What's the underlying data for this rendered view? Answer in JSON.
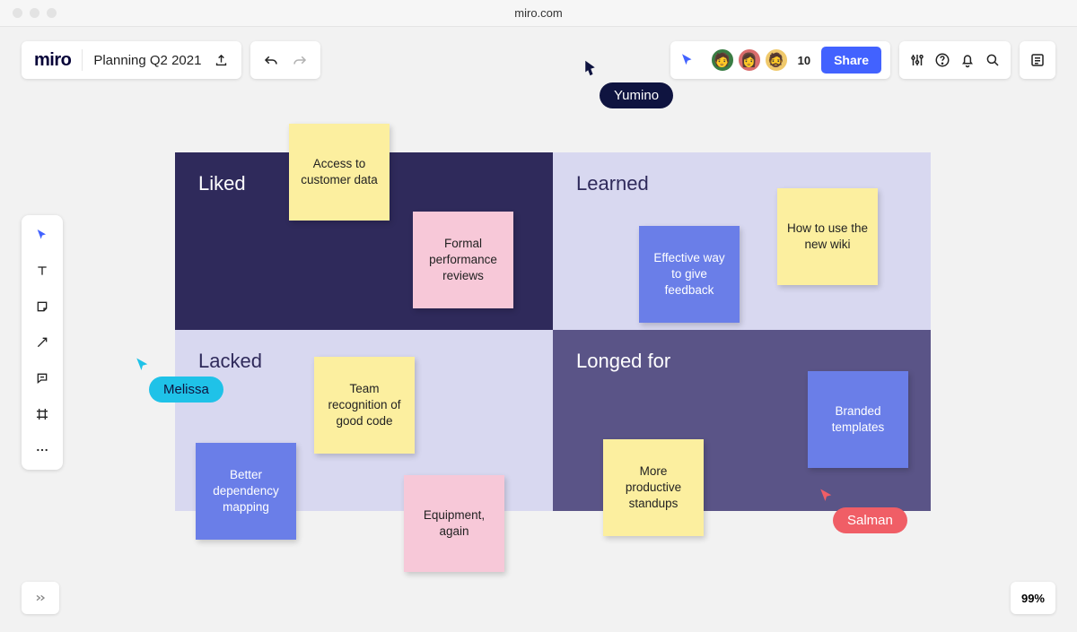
{
  "window": {
    "address": "miro.com"
  },
  "header": {
    "logo_text": "miro",
    "board_title": "Planning Q2 2021",
    "participant_count": "10",
    "share_label": "Share"
  },
  "quadrants": {
    "liked": "Liked",
    "learned": "Learned",
    "lacked": "Lacked",
    "longed": "Longed for"
  },
  "stickies": {
    "access_data": "Access to customer data",
    "formal_reviews": "Formal performance reviews",
    "effective_feedback": "Effective way to give feedback",
    "new_wiki": "How to use the new wiki",
    "team_recognition": "Team recognition of good code",
    "dependency_mapping": "Better dependency mapping",
    "equipment": "Equipment, again",
    "standups": "More productive standups",
    "branded_templates": "Branded templates"
  },
  "cursors": {
    "yumino": "Yumino",
    "melissa": "Melissa",
    "salman": "Salman"
  },
  "zoom": {
    "level": "99%"
  },
  "colors": {
    "accent_blue": "#4262ff",
    "quad_dark": "#2f2a5b",
    "quad_light": "#d8d8f0",
    "quad_mid": "#5a5487",
    "sticky_yellow": "#fcef9f",
    "sticky_pink": "#f7c8d8",
    "sticky_blue": "#6a7ee8",
    "cursor_cyan": "#1fc2e8",
    "cursor_red": "#f05e66"
  }
}
